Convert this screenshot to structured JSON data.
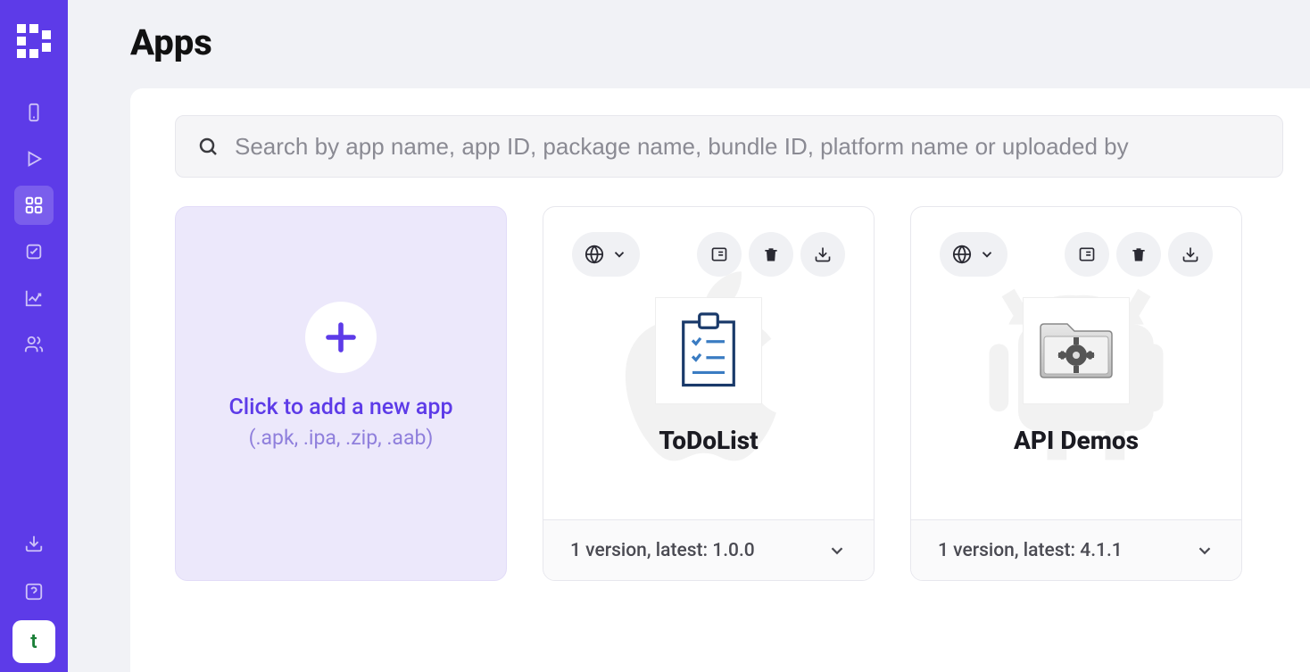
{
  "page": {
    "title": "Apps"
  },
  "search": {
    "placeholder": "Search by app name, app ID, package name, bundle ID, platform name or uploaded by"
  },
  "addCard": {
    "text": "Click to add a new app",
    "hint": "(.apk, .ipa, .zip, .aab)"
  },
  "apps": [
    {
      "name": "ToDoList",
      "platform": "apple",
      "footer": "1 version, latest: 1.0.0"
    },
    {
      "name": "API Demos",
      "platform": "android",
      "footer": "1 version, latest: 4.1.1"
    }
  ],
  "avatar": {
    "initial": "t"
  }
}
